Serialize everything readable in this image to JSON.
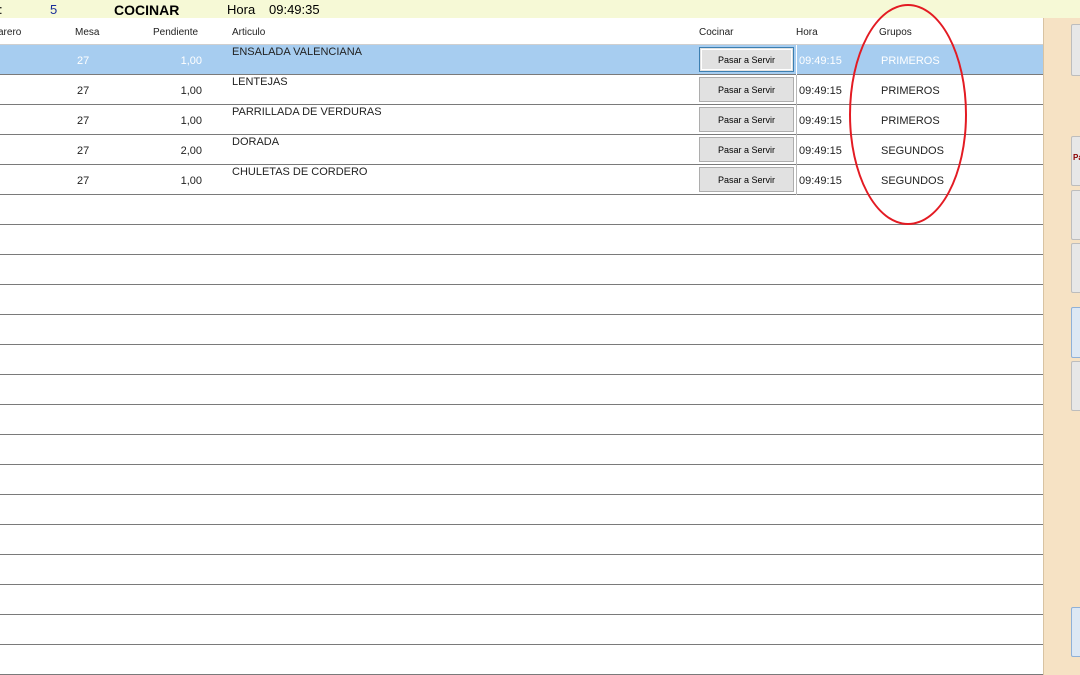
{
  "topbar": {
    "left_fragment": ":",
    "order_number": "5",
    "title": "COCINAR",
    "hora_label": "Hora",
    "hora_value": "09:49:35"
  },
  "table": {
    "columns": {
      "camarero": "arero",
      "mesa": "Mesa",
      "pendiente": "Pendiente",
      "articulo": "Articulo",
      "cocinar": "Cocinar",
      "hora": "Hora",
      "grupos": "Grupos"
    },
    "rows": [
      {
        "mesa": "27",
        "pendiente": "1,00",
        "articulo": "ENSALADA VALENCIANA",
        "button": "Pasar a Servir",
        "hora": "09:49:15",
        "grupo": "PRIMEROS",
        "selected": true
      },
      {
        "mesa": "27",
        "pendiente": "1,00",
        "articulo": "LENTEJAS",
        "button": "Pasar a Servir",
        "hora": "09:49:15",
        "grupo": "PRIMEROS",
        "selected": false
      },
      {
        "mesa": "27",
        "pendiente": "1,00",
        "articulo": "PARRILLADA DE VERDURAS",
        "button": "Pasar a Servir",
        "hora": "09:49:15",
        "grupo": "PRIMEROS",
        "selected": false
      },
      {
        "mesa": "27",
        "pendiente": "2,00",
        "articulo": "DORADA",
        "button": "Pasar a Servir",
        "hora": "09:49:15",
        "grupo": "SEGUNDOS",
        "selected": false
      },
      {
        "mesa": "27",
        "pendiente": "1,00",
        "articulo": "CHULETAS DE CORDERO",
        "button": "Pasar a Servir",
        "hora": "09:49:15",
        "grupo": "SEGUNDOS",
        "selected": false
      }
    ]
  },
  "side_panel": {
    "label_fragment": "Pa"
  },
  "colors": {
    "topbar_bg": "#f6f9d6",
    "selected_row": "#a7cdf0",
    "side_panel_bg": "#f6e2c4",
    "annotation_circle": "#e31b23"
  }
}
